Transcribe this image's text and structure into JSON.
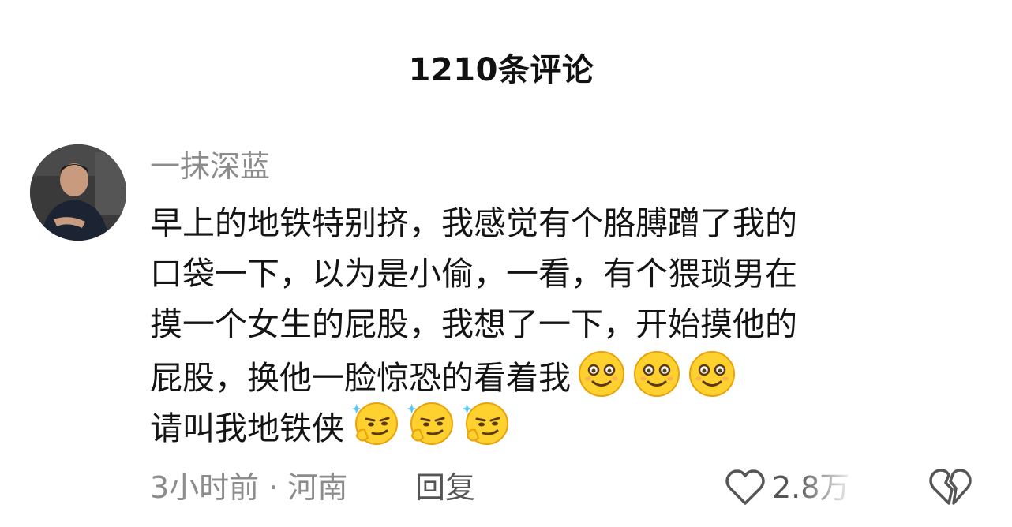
{
  "header": {
    "comment_count_title": "1210条评论"
  },
  "comment": {
    "username": "一抹深蓝",
    "lines": [
      "早上的地铁特别挤，我感觉有个胳膊蹭了我的",
      "口袋一下，以为是小偷，一看，有个猥琐男在",
      "摸一个女生的屁股，我想了一下，开始摸他的",
      "屁股，换他一脸惊恐的看着我",
      "请叫我地铁侠"
    ],
    "line4_emojis": [
      "grinning-face-emoji",
      "grinning-face-emoji",
      "grinning-face-emoji"
    ],
    "line5_emojis": [
      "smug-face-emoji",
      "smug-face-emoji",
      "smug-face-emoji"
    ],
    "meta": "3小时前 · 河南",
    "reply_label": "回复",
    "like_count": "2.8万",
    "icons": {
      "like": "heart-outline-icon",
      "dislike": "broken-heart-icon"
    }
  },
  "colors": {
    "text": "#141414",
    "muted": "#8c8c8c",
    "emoji_yellow": "#FFD12E"
  }
}
